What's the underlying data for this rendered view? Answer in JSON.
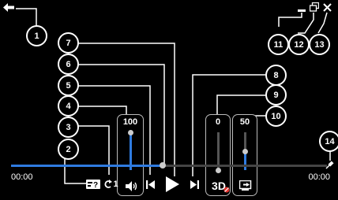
{
  "callouts": [
    "1",
    "2",
    "3",
    "4",
    "5",
    "6",
    "7",
    "8",
    "9",
    "10",
    "11",
    "12",
    "13",
    "14"
  ],
  "volume": {
    "value": "100",
    "level": 1.0
  },
  "balance": {
    "value": "0",
    "level": 0.0
  },
  "speed": {
    "value": "50",
    "level": 0.5
  },
  "time": {
    "elapsed": "00:00",
    "total": "00:00"
  },
  "seek": {
    "progress": 0.48
  },
  "repeat_count": "1",
  "three_d_label": "3D",
  "colors": {
    "accent": "#2f7be0",
    "background": "#000000",
    "foreground": "#ffffff",
    "badge": "#e5322d"
  },
  "icons": [
    "back-arrow-icon",
    "minimize-icon",
    "restore-icon",
    "close-icon",
    "subtitle-icon",
    "repeat-icon",
    "volume-icon",
    "previous-icon",
    "play-icon",
    "next-icon",
    "3d-icon",
    "screen-mode-icon",
    "pin-icon"
  ]
}
